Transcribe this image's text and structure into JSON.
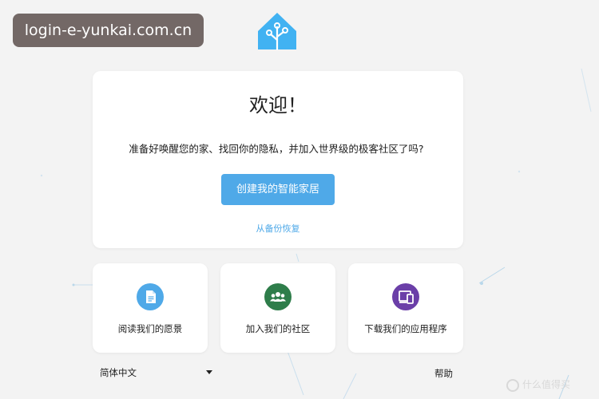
{
  "browser": {
    "url_badge": "login-e-yunkai.com.cn"
  },
  "colors": {
    "primary": "#4fa9e8",
    "logo_blue": "#41b2f2",
    "vision_icon": "#4fa9e8",
    "community_icon": "#2e7d4a",
    "app_icon": "#6b3fa8",
    "badge_bg": "#736866"
  },
  "welcome": {
    "title": "欢迎！",
    "description": "准备好唤醒您的家、找回你的隐私，并加入世界级的极客社区了吗?",
    "create_button": "创建我的智能家居",
    "restore_link": "从备份恢复"
  },
  "cards": [
    {
      "label": "阅读我们的愿景",
      "icon": "document-icon"
    },
    {
      "label": "加入我们的社区",
      "icon": "people-icon"
    },
    {
      "label": "下载我们的应用程序",
      "icon": "devices-icon"
    }
  ],
  "footer": {
    "language": "简体中文",
    "help": "帮助"
  },
  "watermark": {
    "text": "什么值得买"
  }
}
